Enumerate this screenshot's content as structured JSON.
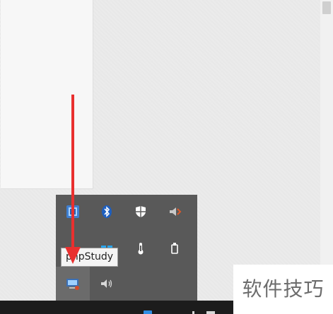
{
  "tray": {
    "tooltip": "phpStudy",
    "icons": [
      {
        "name": "network-app-icon"
      },
      {
        "name": "bluetooth-icon"
      },
      {
        "name": "windows-security-icon"
      },
      {
        "name": "speaker-alert-icon"
      },
      {
        "name": "windows-logo-icon"
      },
      {
        "name": "thermometer-icon"
      },
      {
        "name": "usb-drive-icon"
      },
      {
        "name": "phpstudy-icon"
      },
      {
        "name": "volume-icon"
      }
    ]
  },
  "watermark": {
    "text": "软件技巧"
  },
  "colors": {
    "flyout": "#595959",
    "taskbar": "#1c1c1c",
    "arrow": "#e9302f",
    "accent_blue": "#2f8de4"
  }
}
